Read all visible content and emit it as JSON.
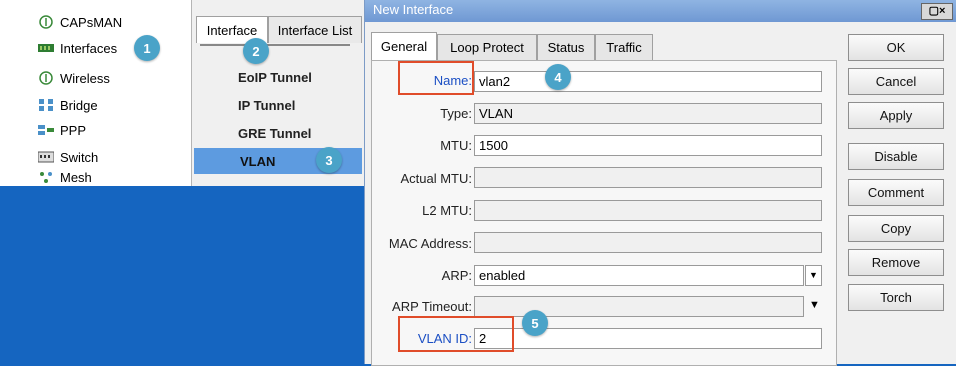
{
  "sidebar": {
    "items": [
      {
        "label": "CAPsMAN",
        "icon": "capsman-icon"
      },
      {
        "label": "Interfaces",
        "icon": "interfaces-icon"
      },
      {
        "label": "Wireless",
        "icon": "wireless-icon"
      },
      {
        "label": "Bridge",
        "icon": "bridge-icon"
      },
      {
        "label": "PPP",
        "icon": "ppp-icon"
      },
      {
        "label": "Switch",
        "icon": "switch-icon"
      },
      {
        "label": "Mesh",
        "icon": "mesh-icon"
      }
    ]
  },
  "middle": {
    "tabs": [
      "Interface",
      "Interface List"
    ],
    "menu": [
      "EoIP Tunnel",
      "IP Tunnel",
      "GRE Tunnel",
      "VLAN"
    ]
  },
  "window": {
    "title": "New Interface",
    "close_glyph": "▢×",
    "tabs": [
      "General",
      "Loop Protect",
      "Status",
      "Traffic"
    ],
    "fields": {
      "name": {
        "label": "Name:",
        "value": "vlan2"
      },
      "type": {
        "label": "Type:",
        "value": "VLAN"
      },
      "mtu": {
        "label": "MTU:",
        "value": "1500"
      },
      "actual_mtu": {
        "label": "Actual MTU:",
        "value": ""
      },
      "l2_mtu": {
        "label": "L2 MTU:",
        "value": ""
      },
      "mac": {
        "label": "MAC Address:",
        "value": ""
      },
      "arp": {
        "label": "ARP:",
        "value": "enabled"
      },
      "arp_timeout": {
        "label": "ARP Timeout:",
        "value": ""
      },
      "vlan_id": {
        "label": "VLAN ID:",
        "value": "2"
      }
    },
    "buttons": [
      "OK",
      "Cancel",
      "Apply",
      "Disable",
      "Comment",
      "Copy",
      "Remove",
      "Torch"
    ]
  },
  "badges": [
    "1",
    "2",
    "3",
    "4",
    "5"
  ],
  "colors": {
    "accent": "#4aa3c8",
    "highlight": "#e04c2a",
    "selected": "#5d9be0",
    "background": "#1565c0"
  }
}
